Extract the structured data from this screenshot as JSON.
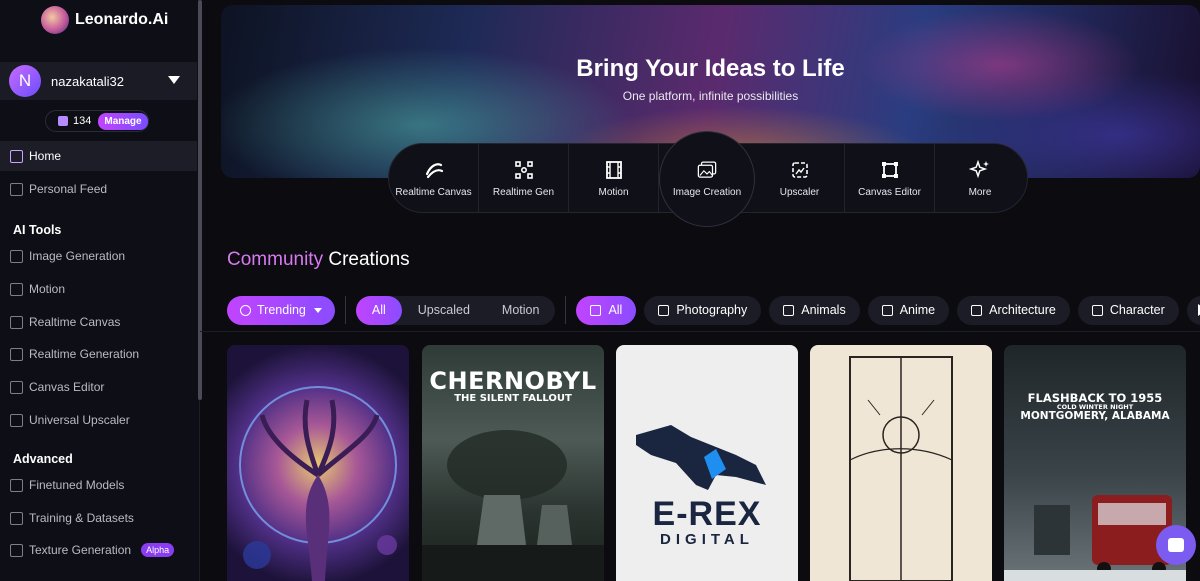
{
  "brand": {
    "name": "Leonardo",
    "suffix": ".Ai"
  },
  "user": {
    "initial": "N",
    "name": "nazakatali32",
    "tokens": "134",
    "manage_label": "Manage"
  },
  "nav": {
    "home": "Home",
    "personal_feed": "Personal Feed",
    "ai_tools_heading": "AI Tools",
    "ai_tools": [
      "Image Generation",
      "Motion",
      "Realtime Canvas",
      "Realtime Generation",
      "Canvas Editor",
      "Universal Upscaler"
    ],
    "advanced_heading": "Advanced",
    "advanced": [
      "Finetuned Models",
      "Training & Datasets",
      "Texture Generation"
    ],
    "alpha_badge": "Alpha"
  },
  "hero": {
    "title": "Bring Your Ideas to Life",
    "subtitle": "One platform, infinite possibilities"
  },
  "quick_tools": [
    "Realtime Canvas",
    "Realtime Gen",
    "Motion",
    "Image Creation",
    "Upscaler",
    "Canvas Editor",
    "More"
  ],
  "community": {
    "title_a": "Community",
    "title_b": " Creations"
  },
  "filters": {
    "sort": "Trending",
    "type_options": [
      "All",
      "Upscaled",
      "Motion"
    ],
    "categories": [
      "All",
      "Photography",
      "Animals",
      "Anime",
      "Architecture",
      "Character"
    ]
  },
  "cards": {
    "chernobyl_title": "CHERNOBYL",
    "chernobyl_sub": "THE SILENT FALLOUT",
    "erex_title": "E-REX",
    "erex_sub": "DIGITAL",
    "flashback_title": "FLASHBACK TO 1955",
    "flashback_mid": "COLD WINTER NIGHT",
    "flashback_loc": "MONTGOMERY, ALABAMA"
  },
  "colors": {
    "accent": "#c244ff",
    "accent2": "#8a4cff",
    "bg": "#0b0b10"
  }
}
